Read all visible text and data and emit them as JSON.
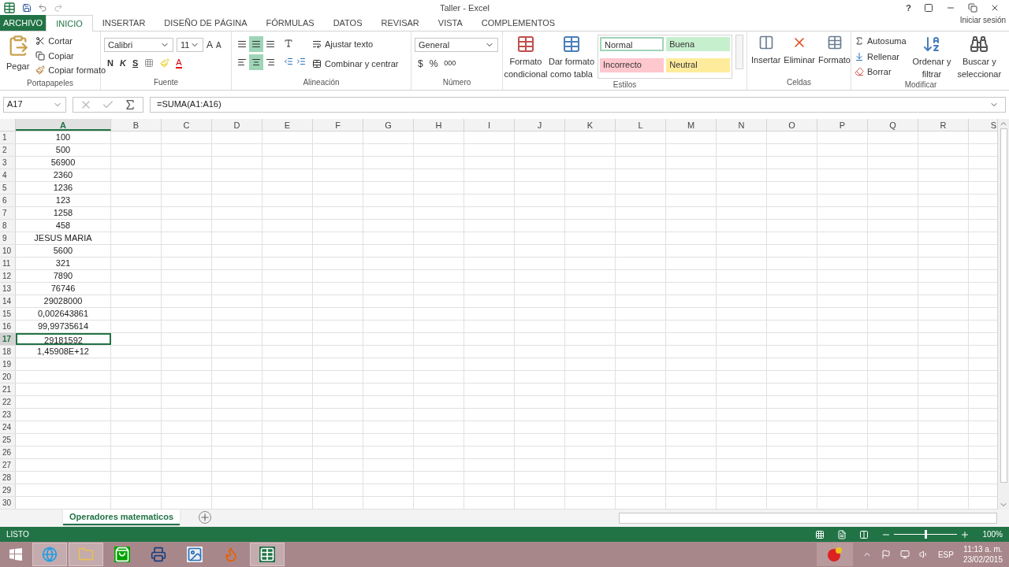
{
  "window": {
    "title": "Taller - Excel",
    "help": "?",
    "sign_in": "Iniciar sesión"
  },
  "ribbon_tabs": [
    {
      "label": "ARCHIVO",
      "kind": "file",
      "selected": false
    },
    {
      "label": "INICIO",
      "kind": "tab",
      "selected": true
    },
    {
      "label": "INSERTAR",
      "kind": "tab",
      "selected": false
    },
    {
      "label": "DISEÑO DE PÁGINA",
      "kind": "tab",
      "selected": false
    },
    {
      "label": "FÓRMULAS",
      "kind": "tab",
      "selected": false
    },
    {
      "label": "DATOS",
      "kind": "tab",
      "selected": false
    },
    {
      "label": "REVISAR",
      "kind": "tab",
      "selected": false
    },
    {
      "label": "VISTA",
      "kind": "tab",
      "selected": false
    },
    {
      "label": "COMPLEMENTOS",
      "kind": "tab",
      "selected": false
    }
  ],
  "clipboard": {
    "label": "Portapapeles",
    "paste": "Pegar",
    "cut": "Cortar",
    "copy": "Copiar",
    "format_painter": "Copiar formato"
  },
  "font": {
    "label": "Fuente",
    "family": "Calibri",
    "size": "11",
    "grow": "A",
    "shrink": "A",
    "bold": "N",
    "italic": "K",
    "underline": "S",
    "font_color_label": "A"
  },
  "alignment": {
    "label": "Alineación",
    "vertical": [
      {
        "selected": false
      },
      {
        "selected": true
      },
      {
        "selected": false
      }
    ],
    "horizontal": [
      {
        "selected": false
      },
      {
        "selected": true
      },
      {
        "selected": false
      }
    ],
    "wrap": "Ajustar texto",
    "merge": "Combinar y centrar"
  },
  "number": {
    "label": "Número",
    "format": "General",
    "currency": "$",
    "percent": "%",
    "thousands": "000"
  },
  "styles": {
    "label": "Estilos",
    "conditional": [
      "Formato",
      "condicional"
    ],
    "as_table": [
      "Dar formato",
      "como tabla"
    ],
    "items": [
      {
        "label": "Normal",
        "color": "#ffffff",
        "selected": true
      },
      {
        "label": "Buena",
        "color": "#c6efce",
        "selected": false
      },
      {
        "label": "Incorrecto",
        "color": "#ffc7ce",
        "selected": false
      },
      {
        "label": "Neutral",
        "color": "#ffeb9c",
        "selected": false
      }
    ]
  },
  "cells": {
    "label": "Celdas",
    "buttons": [
      "Insertar",
      "Eliminar",
      "Formato"
    ]
  },
  "editing": {
    "label": "Modificar",
    "autosum": "Autosuma",
    "fill": "Rellenar",
    "clear": "Borrar",
    "sort": [
      "Ordenar y",
      "filtrar"
    ],
    "find": [
      "Buscar y",
      "seleccionar"
    ]
  },
  "formula_bar": {
    "name_box": "A17",
    "formula": "=SUMA(A1:A16)"
  },
  "columns": [
    {
      "label": "A",
      "selected": true
    },
    {
      "label": "B",
      "selected": false
    },
    {
      "label": "C",
      "selected": false
    },
    {
      "label": "D",
      "selected": false
    },
    {
      "label": "E",
      "selected": false
    },
    {
      "label": "F",
      "selected": false
    },
    {
      "label": "G",
      "selected": false
    },
    {
      "label": "H",
      "selected": false
    },
    {
      "label": "I",
      "selected": false
    },
    {
      "label": "J",
      "selected": false
    },
    {
      "label": "K",
      "selected": false
    },
    {
      "label": "L",
      "selected": false
    },
    {
      "label": "M",
      "selected": false
    },
    {
      "label": "N",
      "selected": false
    },
    {
      "label": "O",
      "selected": false
    },
    {
      "label": "P",
      "selected": false
    },
    {
      "label": "Q",
      "selected": false
    },
    {
      "label": "R",
      "selected": false
    },
    {
      "label": "S",
      "selected": false
    }
  ],
  "rows": [
    {
      "number": "1",
      "a": "100",
      "selected": false
    },
    {
      "number": "2",
      "a": "500",
      "selected": false
    },
    {
      "number": "3",
      "a": "56900",
      "selected": false
    },
    {
      "number": "4",
      "a": "2360",
      "selected": false
    },
    {
      "number": "5",
      "a": "1236",
      "selected": false
    },
    {
      "number": "6",
      "a": "123",
      "selected": false
    },
    {
      "number": "7",
      "a": "1258",
      "selected": false
    },
    {
      "number": "8",
      "a": "458",
      "selected": false
    },
    {
      "number": "9",
      "a": "JESUS MARIA",
      "selected": false
    },
    {
      "number": "10",
      "a": "5600",
      "selected": false
    },
    {
      "number": "11",
      "a": "321",
      "selected": false
    },
    {
      "number": "12",
      "a": "7890",
      "selected": false
    },
    {
      "number": "13",
      "a": "76746",
      "selected": false
    },
    {
      "number": "14",
      "a": "29028000",
      "selected": false
    },
    {
      "number": "15",
      "a": "0,002643861",
      "selected": false
    },
    {
      "number": "16",
      "a": "99,99735614",
      "selected": false
    },
    {
      "number": "17",
      "a": "29181592",
      "selected": true
    },
    {
      "number": "18",
      "a": "1,45908E+12",
      "selected": false
    },
    {
      "number": "19",
      "selected": false
    },
    {
      "number": "20",
      "selected": false
    },
    {
      "number": "21",
      "selected": false
    },
    {
      "number": "22",
      "selected": false
    },
    {
      "number": "23",
      "selected": false
    },
    {
      "number": "24",
      "selected": false
    },
    {
      "number": "25",
      "selected": false
    },
    {
      "number": "26",
      "selected": false
    },
    {
      "number": "27",
      "selected": false
    },
    {
      "number": "28",
      "selected": false
    },
    {
      "number": "29",
      "selected": false
    },
    {
      "number": "30",
      "selected": false
    }
  ],
  "sheet_tabs": [
    {
      "label": "Operadores matematicos",
      "selected": true
    }
  ],
  "status_bar": {
    "state": "LISTO",
    "zoom": "100%",
    "zoom_slider": {
      "level": 0.5
    }
  },
  "taskbar": {
    "apps": [
      {
        "kind": "browser",
        "open": true
      },
      {
        "kind": "folder",
        "open": true
      },
      {
        "kind": "store",
        "open": false
      },
      {
        "kind": "scanner",
        "open": false
      },
      {
        "kind": "photos",
        "open": false
      },
      {
        "kind": "firefox",
        "open": false
      },
      {
        "kind": "excel",
        "open": true
      }
    ],
    "language": "ESP",
    "time": "11:13 a. m.",
    "date": "23/02/2015"
  }
}
